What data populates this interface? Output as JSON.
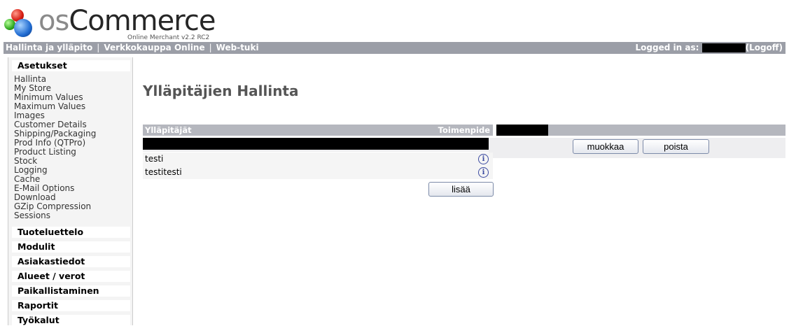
{
  "logo": {
    "os": "os",
    "commerce": "Commerce",
    "subtitle": "Online Merchant v2.2 RC2"
  },
  "topbar": {
    "links": [
      "Hallinta ja ylläpito",
      "Verkkokauppa Online",
      "Web-tuki"
    ],
    "separator": "|",
    "logged_in_label": "Logged in as:",
    "logoff": "(Logoff)"
  },
  "sidebar": {
    "settings_header": "Asetukset",
    "settings_links": [
      "Hallinta",
      "My Store",
      "Minimum Values",
      "Maximum Values",
      "Images",
      "Customer Details",
      "Shipping/Packaging",
      "Prod Info (QTPro)",
      "Product Listing",
      "Stock",
      "Logging",
      "Cache",
      "E-Mail Options",
      "Download",
      "GZip Compression",
      "Sessions"
    ],
    "sections": [
      "Tuoteluettelo",
      "Modulit",
      "Asiakastiedot",
      "Alueet / verot",
      "Paikallistaminen",
      "Raportit",
      "Työkalut"
    ]
  },
  "main": {
    "title": "Ylläpitäjien Hallinta",
    "table": {
      "col_admins": "Ylläpitäjät",
      "col_action": "Toimenpide",
      "rows": [
        {
          "name": "testi",
          "icon": "info-icon"
        },
        {
          "name": "testitesti",
          "icon": "info-icon"
        }
      ]
    },
    "buttons": {
      "add": "lisää",
      "edit": "muokkaa",
      "delete": "poista"
    }
  },
  "colors": {
    "topbar": "#9b9ea7",
    "table_header": "#b5b7be",
    "title": "#555555"
  }
}
